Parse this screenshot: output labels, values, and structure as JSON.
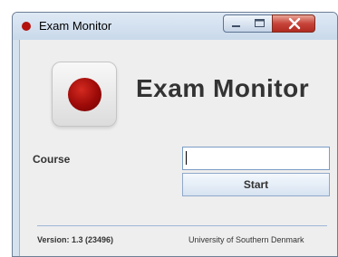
{
  "window": {
    "title": "Exam Monitor",
    "buttons": [
      "minimize",
      "maximize",
      "close"
    ]
  },
  "header": {
    "logo_icon": "record-icon",
    "title": "Exam Monitor"
  },
  "form": {
    "course_label": "Course",
    "course_value": "",
    "start_label": "Start"
  },
  "footer": {
    "version": "Version: 1.3 (23496)",
    "university": "University of Southern Denmark"
  },
  "colors": {
    "accent_red": "#a50b08",
    "close_button": "#c7443a"
  }
}
